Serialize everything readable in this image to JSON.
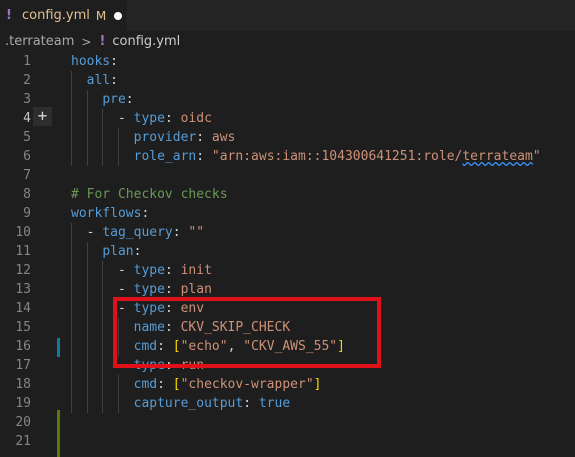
{
  "tab": {
    "icon": "yaml-icon",
    "title": "config.yml",
    "status": "M"
  },
  "breadcrumb": {
    "folder": ".terrateam",
    "file": "config.yml"
  },
  "editor": {
    "active_line": "4",
    "line_numbers": [
      "1",
      "2",
      "3",
      "4",
      "5",
      "6",
      "7",
      "8",
      "9",
      "10",
      "11",
      "12",
      "13",
      "14",
      "15",
      "16",
      "17",
      "18",
      "19",
      "20",
      "21"
    ],
    "lines": {
      "l1_key": "hooks",
      "l2_key": "all",
      "l3_key": "pre",
      "l4_key": "type",
      "l4_val": "oidc",
      "l5_key": "provider",
      "l5_val": "aws",
      "l6_key": "role_arn",
      "l6_val_a": "\"arn:aws:iam::104300641251:role/",
      "l6_val_b": "terrateam",
      "l6_val_c": "\"",
      "l8_comment": "# For Checkov checks",
      "l9_key": "workflows",
      "l10_key": "tag_query",
      "l10_val": "\"\"",
      "l11_key": "plan",
      "l12_key": "type",
      "l12_val": "init",
      "l13_key": "type",
      "l13_val": "plan",
      "l14_key": "type",
      "l14_val": "env",
      "l15_key": "name",
      "l15_val": "CKV_SKIP_CHECK",
      "l16_key": "cmd",
      "l16_val1": "\"echo\"",
      "l16_val2": "\"CKV_AWS_55\"",
      "l17_key": "type",
      "l17_val": "run",
      "l18_key": "cmd",
      "l18_val": "\"checkov-wrapper\"",
      "l19_key": "capture_output",
      "l19_val": "true"
    }
  },
  "colors": {
    "highlight_box": "#e0101a",
    "accent": "#569cd6"
  }
}
